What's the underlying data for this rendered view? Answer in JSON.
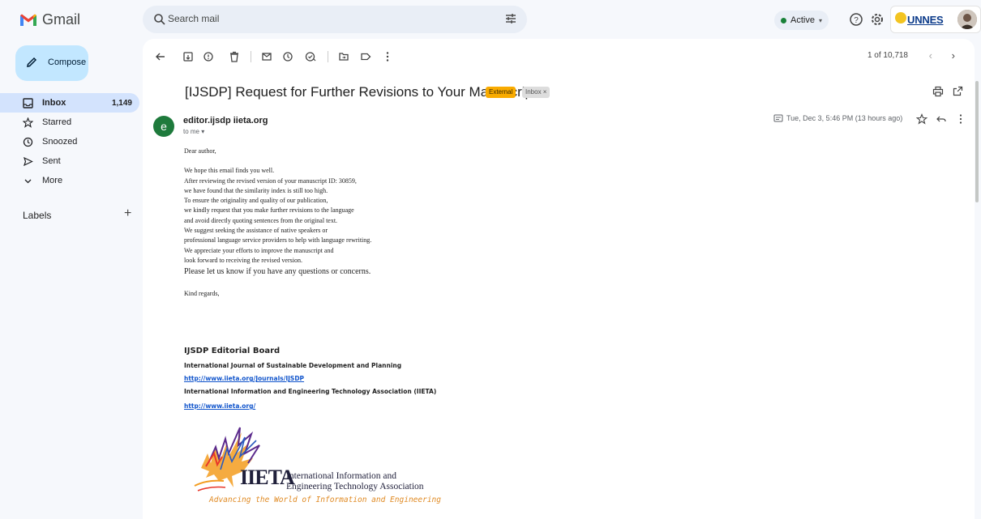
{
  "app": {
    "name": "Gmail"
  },
  "search": {
    "placeholder": "Search mail"
  },
  "status": {
    "label": "Active"
  },
  "account": {
    "org": "UNNES"
  },
  "compose": {
    "label": "Compose"
  },
  "sidebar": {
    "items": [
      {
        "label": "Inbox",
        "count": "1,149",
        "icon": "inbox-icon"
      },
      {
        "label": "Starred",
        "count": "",
        "icon": "star-icon"
      },
      {
        "label": "Snoozed",
        "count": "",
        "icon": "clock-icon"
      },
      {
        "label": "Sent",
        "count": "",
        "icon": "send-icon"
      },
      {
        "label": "More",
        "count": "",
        "icon": "chevron-down-icon"
      }
    ],
    "labels_heading": "Labels",
    "labels_add": "+"
  },
  "toolbar": {
    "pager": "1 of 10,718"
  },
  "email": {
    "subject": "[IJSDP] Request for Further Revisions to Your Manuscript",
    "badge_external": "External",
    "badge_inbox": "Inbox ×",
    "sender_initial": "e",
    "sender": "editor.ijsdp iieta.org",
    "to": "to me ▾",
    "date": "Tue, Dec 3, 5:46 PM (13 hours ago)",
    "greeting": "Dear author,",
    "lines": [
      "We hope this email finds you well.",
      "After reviewing the revised version of your manuscript ID: 30859,",
      "we have found that the similarity index is still too high.",
      "To ensure the originality and quality of our publication,",
      "we kindly request that you make further revisions to the language",
      "and avoid directly quoting sentences from the original text.",
      "We suggest seeking the assistance of native speakers or",
      "professional language service providers to help with language rewriting.",
      "We appreciate your efforts to improve the manuscript and",
      "look forward to receiving the revised version."
    ],
    "closing_big": "Please let us know if you have any questions or concerns.",
    "regards": "Kind regards,",
    "sig_title": "IJSDP Editorial Board",
    "sig_journal": "International Journal of Sustainable Development and Planning",
    "sig_link1": "http://www.iieta.org/Journals/IJSDP",
    "sig_assoc": "International Information and Engineering Technology Association (IIETA)",
    "sig_link2": "http://www.iieta.org/"
  },
  "logo": {
    "mark": "IIETA",
    "line1": "International Information and",
    "line2": "Engineering Technology Association",
    "tagline": "Advancing the World of Information and Engineering"
  }
}
